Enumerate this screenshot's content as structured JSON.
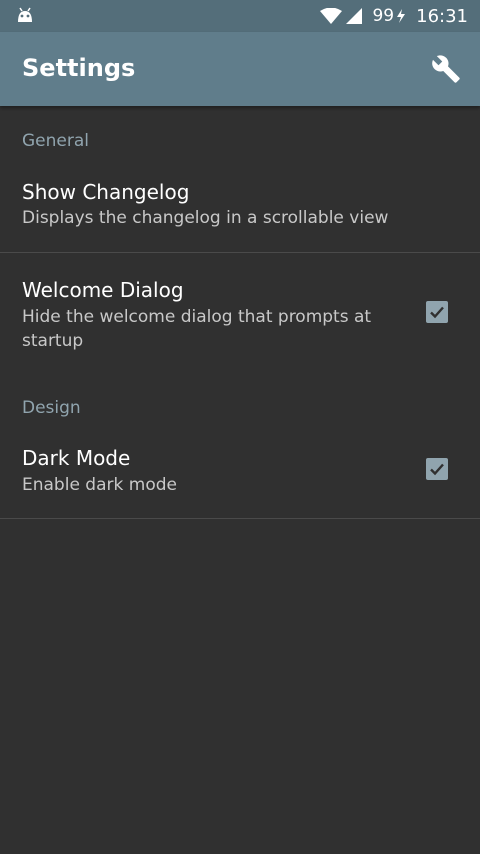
{
  "status_bar": {
    "battery": "99",
    "time": "16:31"
  },
  "toolbar": {
    "title": "Settings"
  },
  "sections": [
    {
      "header": "General",
      "items": [
        {
          "title": "Show Changelog",
          "summary": "Displays the changelog in a scrollable view",
          "has_checkbox": false
        },
        {
          "title": "Welcome Dialog",
          "summary": "Hide the welcome dialog that prompts at startup",
          "has_checkbox": true,
          "checked": true
        }
      ]
    },
    {
      "header": "Design",
      "items": [
        {
          "title": "Dark Mode",
          "summary": "Enable dark mode",
          "has_checkbox": true,
          "checked": true
        }
      ]
    }
  ],
  "colors": {
    "status_bar": "#546E7A",
    "toolbar": "#607D8B",
    "background": "#303030",
    "category_text": "#90A4AE",
    "checkbox": "#90A4AE"
  },
  "icons": {
    "notification": "android-icon",
    "wifi": "wifi-icon",
    "signal": "signal-icon",
    "charging": "charging-bolt-icon",
    "toolbar_action": "wrench-icon",
    "check": "check-icon"
  }
}
